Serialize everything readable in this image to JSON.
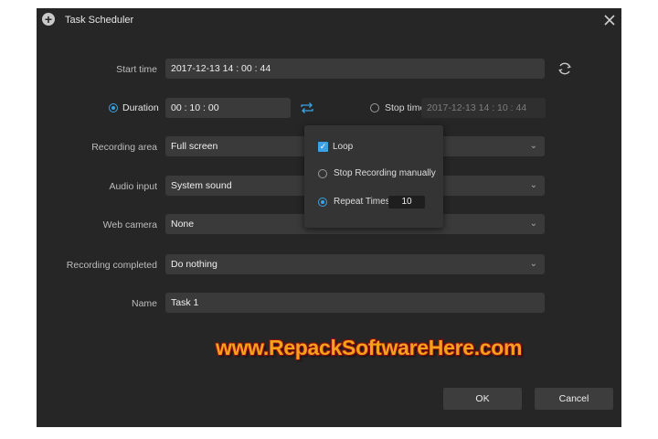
{
  "window": {
    "title": "Task Scheduler"
  },
  "form": {
    "start_time": {
      "label": "Start time",
      "value": "2017-12-13 14 : 00 : 44"
    },
    "duration": {
      "label": "Duration",
      "value": "00 : 10 : 00",
      "selected": true
    },
    "stop_time": {
      "label": "Stop time",
      "value": "2017-12-13 14 : 10 : 44",
      "selected": false
    },
    "recording_area": {
      "label": "Recording area",
      "value": "Full screen"
    },
    "audio_input": {
      "label": "Audio input",
      "value": "System sound"
    },
    "web_camera": {
      "label": "Web camera",
      "value": "None"
    },
    "recording_completed": {
      "label": "Recording completed",
      "value": "Do nothing"
    },
    "name": {
      "label": "Name",
      "value": "Task 1"
    }
  },
  "popup": {
    "loop_label": "Loop",
    "loop_checked": true,
    "stop_manual_label": "Stop Recording manually",
    "repeat_label": "Repeat Times",
    "repeat_value": "10",
    "selected": "repeat"
  },
  "buttons": {
    "ok": "OK",
    "cancel": "Cancel"
  },
  "watermark": "www.RepackSoftwareHere.com",
  "colors": {
    "accent": "#3aa3e6",
    "background": "#262626",
    "field": "#3a3a3a",
    "watermark": "#f3a21a"
  },
  "icons": {
    "app": "plus-circle-icon",
    "close": "close-icon",
    "refresh": "refresh-icon",
    "loop": "loop-arrows-icon",
    "dropdown": "chevron-down-icon"
  }
}
